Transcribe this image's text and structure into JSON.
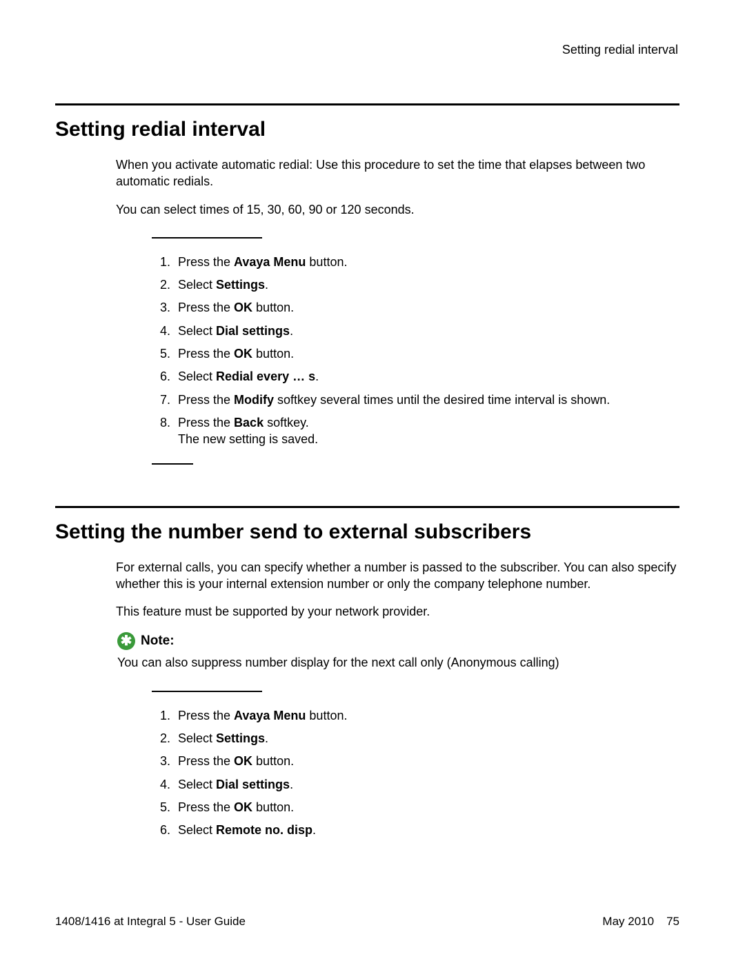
{
  "header": {
    "right": "Setting redial interval"
  },
  "section1": {
    "heading": "Setting redial interval",
    "p1": "When you activate automatic redial: Use this procedure to set the time that elapses between two automatic redials.",
    "p2": "You can select times of 15, 30, 60, 90 or 120 seconds.",
    "steps": {
      "s1a": "Press the ",
      "s1b": "Avaya Menu",
      "s1c": " button.",
      "s2a": "Select ",
      "s2b": "Settings",
      "s2c": ".",
      "s3a": "Press the ",
      "s3b": "OK",
      "s3c": " button.",
      "s4a": "Select ",
      "s4b": "Dial settings",
      "s4c": ".",
      "s5a": "Press the ",
      "s5b": "OK",
      "s5c": " button.",
      "s6a": "Select ",
      "s6b": "Redial every … s",
      "s6c": ".",
      "s7a": "Press the ",
      "s7b": "Modify",
      "s7c": " softkey several times until the desired time interval is shown.",
      "s8a": "Press the ",
      "s8b": "Back",
      "s8c": " softkey.",
      "s8d": "The new setting is saved."
    }
  },
  "section2": {
    "heading": "Setting the number send to external subscribers",
    "p1": "For external calls, you can specify whether a number is passed to the subscriber. You can also specify whether this is your internal extension number or only the company telephone number.",
    "p2": "This feature must be supported by your network provider.",
    "note": {
      "label": "Note:",
      "text": "You can also suppress number display for the next call only (Anonymous calling)"
    },
    "steps": {
      "s1a": "Press the ",
      "s1b": "Avaya Menu",
      "s1c": " button.",
      "s2a": "Select ",
      "s2b": "Settings",
      "s2c": ".",
      "s3a": "Press the ",
      "s3b": "OK",
      "s3c": " button.",
      "s4a": "Select ",
      "s4b": "Dial settings",
      "s4c": ".",
      "s5a": "Press the ",
      "s5b": "OK",
      "s5c": " button.",
      "s6a": "Select ",
      "s6b": "Remote no. disp",
      "s6c": "."
    }
  },
  "footer": {
    "left": "1408/1416 at Integral 5 - User Guide",
    "date": "May 2010",
    "page": "75"
  }
}
